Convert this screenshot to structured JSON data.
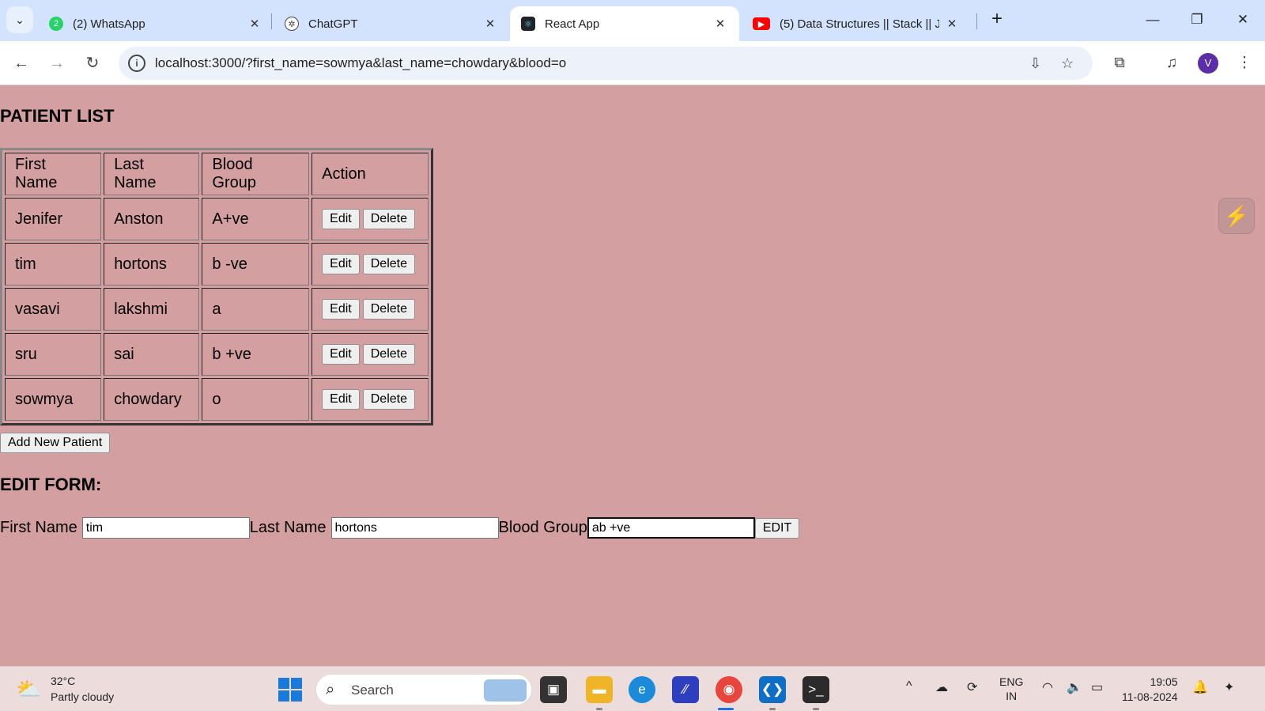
{
  "browser": {
    "tabs": [
      {
        "title": "(2) WhatsApp",
        "favicon": "whatsapp-icon",
        "color": "#25d366"
      },
      {
        "title": "ChatGPT",
        "favicon": "chatgpt-icon",
        "color": "#444444"
      },
      {
        "title": "React App",
        "favicon": "react-icon",
        "color": "#20232a"
      },
      {
        "title": "(5) Data Structures || Stack || Jav",
        "favicon": "youtube-icon",
        "color": "#ff0000"
      }
    ],
    "active_tab": 2,
    "url": "localhost:3000/?first_name=sowmya&last_name=chowdary&blood=o",
    "profile_initial": "V"
  },
  "page": {
    "title": "PATIENT LIST",
    "table": {
      "headers": [
        "First Name",
        "Last Name",
        "Blood Group",
        "Action"
      ],
      "rows": [
        {
          "first": "Jenifer",
          "last": "Anston",
          "blood": "A+ve"
        },
        {
          "first": "tim",
          "last": "hortons",
          "blood": "b -ve"
        },
        {
          "first": "vasavi",
          "last": "lakshmi",
          "blood": "a"
        },
        {
          "first": "sru",
          "last": "sai",
          "blood": "b +ve"
        },
        {
          "first": "sowmya",
          "last": "chowdary",
          "blood": "o"
        }
      ],
      "edit_label": "Edit",
      "delete_label": "Delete"
    },
    "add_button": "Add New Patient",
    "edit_form": {
      "heading": "EDIT FORM:",
      "first_name_label": "First Name",
      "first_name_value": "tim",
      "last_name_label": "Last Name",
      "last_name_value": "hortons",
      "blood_group_label": "Blood Group",
      "blood_group_value": "ab +ve",
      "submit_label": "EDIT"
    }
  },
  "taskbar": {
    "weather_temp": "32°C",
    "weather_desc": "Partly cloudy",
    "search_label": "Search",
    "lang_line1": "ENG",
    "lang_line2": "IN",
    "time": "19:05",
    "date": "11-08-2024"
  },
  "colors": {
    "page_bg": "#d49fa0",
    "tabstrip_bg": "#d3e3fd",
    "taskbar_bg": "#ecdcdc"
  }
}
